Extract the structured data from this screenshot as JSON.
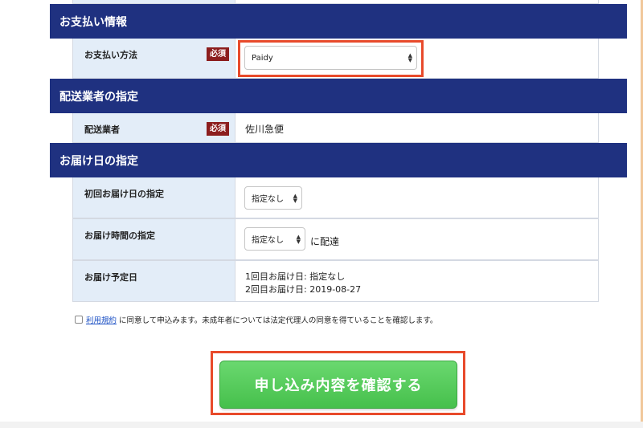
{
  "payment_section": {
    "title": "お支払い情報",
    "method_label": "お支払い方法",
    "required": "必須",
    "method_value": "Paidy"
  },
  "carrier_section": {
    "title": "配送業者の指定",
    "carrier_label": "配送業者",
    "required": "必須",
    "carrier_value": "佐川急便"
  },
  "delivery_section": {
    "title": "お届け日の指定",
    "first_date_label": "初回お届け日の指定",
    "first_date_value": "指定なし",
    "time_label": "お届け時間の指定",
    "time_value": "指定なし",
    "time_suffix": "に配達",
    "scheduled_label": "お届け予定日",
    "scheduled_line1": "1回目お届け日: 指定なし",
    "scheduled_line2": "2回目お届け日: 2019-08-27"
  },
  "consent": {
    "link_text": "利用規約",
    "text": "に同意して申込みます。未成年者については法定代理人の同意を得ていることを確認します。",
    "checked": false
  },
  "submit": {
    "label": "申し込み内容を確認する"
  },
  "colors": {
    "header_bg": "#1f3180",
    "label_bg": "#e3edf8",
    "required_badge": "#8c1e1e",
    "highlight": "#e84a2b",
    "submit_green": "#4cc452"
  }
}
